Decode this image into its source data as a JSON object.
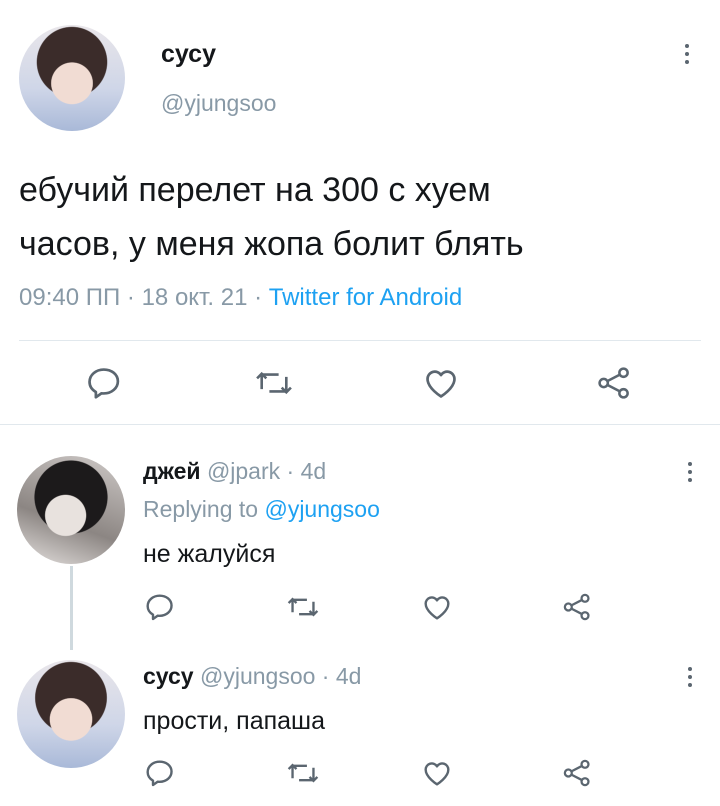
{
  "main_tweet": {
    "display_name": "сусу",
    "handle": "@yjungsoo",
    "text_line1": "ебучий перелет на 300 с хуем",
    "text_line2": "часов, у меня жопа болит блять",
    "time": "09:40 ПП",
    "sep1": "·",
    "date": "18 окт. 21",
    "sep2": "·",
    "client": "Twitter for Android"
  },
  "replies": [
    {
      "display_name": "джей",
      "handle": "@jpark",
      "sep": "·",
      "age": "4d",
      "replying_prefix": "Replying to",
      "replying_handle": "@yjungsoo",
      "text": "не жалуйся"
    },
    {
      "display_name": "сусу",
      "handle": "@yjungsoo",
      "sep": "·",
      "age": "4d",
      "text": "прости, папаша"
    }
  ],
  "icons": {
    "reply": "reply-icon",
    "retweet": "retweet-icon",
    "like": "like-icon",
    "share": "share-icon",
    "more": "more-icon"
  },
  "colors": {
    "accent": "#1da1f2",
    "muted": "#8899a6",
    "text": "#14171a",
    "icon": "#5b6670"
  }
}
